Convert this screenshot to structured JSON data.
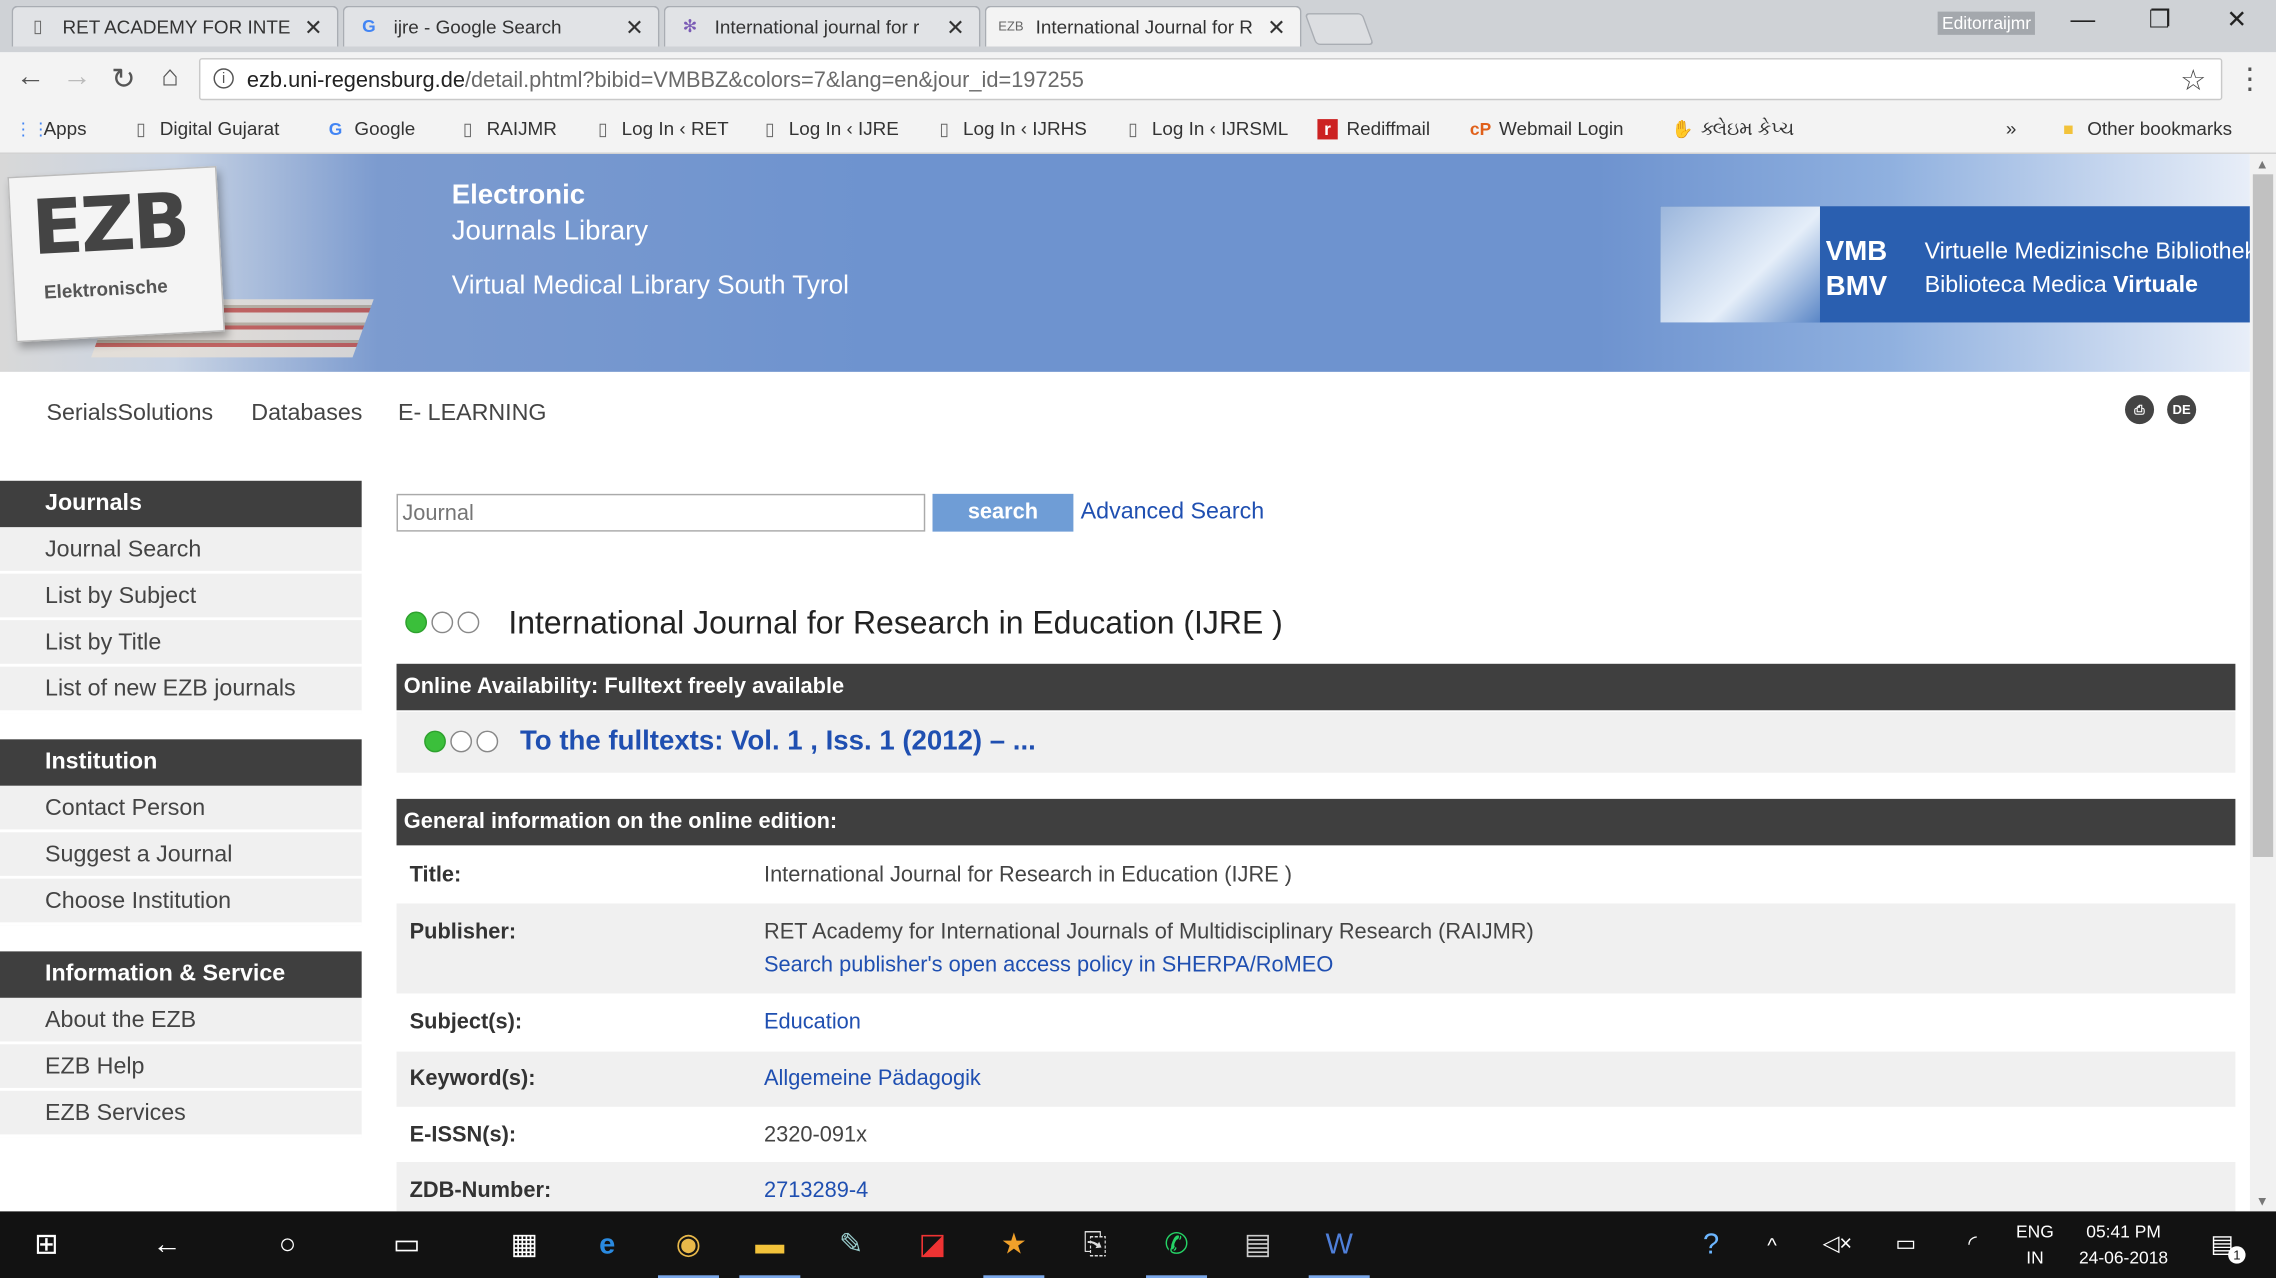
{
  "browser": {
    "tabs": [
      {
        "title": "RET ACADEMY FOR INTE",
        "icon": "page-icon"
      },
      {
        "title": "ijre - Google Search",
        "icon": "google-icon"
      },
      {
        "title": "International journal for r",
        "icon": "loading-icon"
      },
      {
        "title": "International Journal for R",
        "icon": "ezb-icon"
      }
    ],
    "profile_name": "Editorraijmr",
    "url_domain": "ezb.uni-regensburg.de",
    "url_path": "/detail.phtml?bibid=VMBBZ&colors=7&lang=en&jour_id=197255",
    "bookmarks": [
      {
        "label": "Apps",
        "icon": "apps-icon"
      },
      {
        "label": "Digital Gujarat",
        "icon": "page-icon"
      },
      {
        "label": "Google",
        "icon": "google-icon"
      },
      {
        "label": "RAIJMR",
        "icon": "page-icon"
      },
      {
        "label": "Log In ‹ RET",
        "icon": "page-icon"
      },
      {
        "label": "Log In ‹ IJRE",
        "icon": "page-icon"
      },
      {
        "label": "Log In ‹ IJRHS",
        "icon": "page-icon"
      },
      {
        "label": "Log In ‹ IJRSML",
        "icon": "page-icon"
      },
      {
        "label": "Rediffmail",
        "icon": "rediff-icon"
      },
      {
        "label": "Webmail Login",
        "icon": "webmail-icon"
      },
      {
        "label": "ક્લેઇમ કેપ્ચ",
        "icon": "hand-icon"
      }
    ],
    "overflow": "»",
    "other_bookmarks": "Other bookmarks"
  },
  "header": {
    "title_line1": "Electronic",
    "title_line2": "Journals Library",
    "subtitle": "Virtual Medical Library South Tyrol",
    "logo_text": "EZB",
    "logo_sub": "Elektronische",
    "vmb_abbr1": "VMB",
    "vmb_abbr2": "BMV",
    "vmb_name1": "Virtuelle Medizinische Bibliothek",
    "vmb_name2_prefix": "Biblioteca Medica ",
    "vmb_name2_bold": "Virtuale"
  },
  "topnav": [
    "SerialsSolutions",
    "Databases",
    "E- LEARNING"
  ],
  "lang_icon": "DE",
  "sidebar": {
    "sections": [
      {
        "heading": "Journals",
        "items": [
          "Journal Search",
          "List by Subject",
          "List by Title",
          "List of new EZB journals"
        ]
      },
      {
        "heading": "Institution",
        "items": [
          "Contact Person",
          "Suggest a Journal",
          "Choose Institution"
        ]
      },
      {
        "heading": "Information & Service",
        "items": [
          "About the EZB",
          "EZB Help",
          "EZB Services"
        ]
      }
    ]
  },
  "search": {
    "placeholder": "Journal",
    "button": "search",
    "advanced": "Advanced Search"
  },
  "journal": {
    "title": "International Journal for Research in Education (IJRE )",
    "availability_heading": "Online Availability: Fulltext freely available",
    "fulltext_link": "To the fulltexts: Vol. 1 , Iss. 1 (2012) – ...",
    "general_heading": "General information on the online edition:",
    "fields": {
      "title_label": "Title:",
      "title_value": "International Journal for Research in Education (IJRE )",
      "publisher_label": "Publisher:",
      "publisher_value": "RET Academy for International Journals of Multidisciplinary Research (RAIJMR)",
      "publisher_link": "Search publisher's open access policy in SHERPA/RoMEO",
      "subjects_label": "Subject(s):",
      "subjects_value": "Education",
      "keywords_label": "Keyword(s):",
      "keywords_value": "Allgemeine Pädagogik",
      "eissn_label": "E-ISSN(s):",
      "eissn_value": "2320-091x",
      "zdb_label": "ZDB-Number:",
      "zdb_value": "2713289-4"
    }
  },
  "taskbar": {
    "lang_top": "ENG",
    "lang_bottom": "IN",
    "time": "05:41 PM",
    "date": "24-06-2018",
    "notifications": "1"
  },
  "colors": {
    "banner_blue": "#6e93cf",
    "dark_bar": "#3f3f3f",
    "link_blue": "#1f4fb1",
    "search_button": "#6f9dd6",
    "availability_green": "#3bbf3b"
  }
}
